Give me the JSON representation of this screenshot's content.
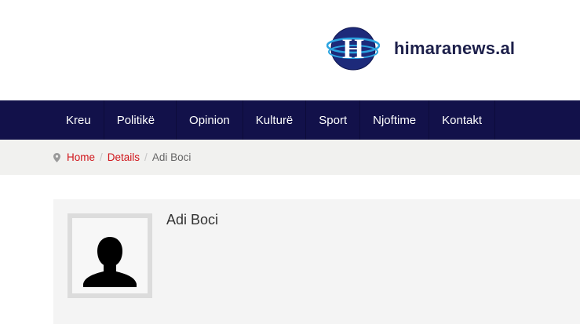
{
  "header": {
    "logo_text": "himaranews.al",
    "logo_mark_letter": "H"
  },
  "nav": {
    "items": [
      {
        "label": "Kreu"
      },
      {
        "label": "Politikë"
      },
      {
        "label": "Opinion"
      },
      {
        "label": "Kulturë"
      },
      {
        "label": "Sport"
      },
      {
        "label": "Njoftime"
      },
      {
        "label": "Kontakt"
      }
    ]
  },
  "breadcrumb": {
    "icon": "map-pin-icon",
    "items": [
      "Home",
      "Details"
    ],
    "separator": "/",
    "current": "Adi Boci"
  },
  "profile": {
    "name": "Adi Boci",
    "avatar_icon": "person-silhouette-icon"
  },
  "colors": {
    "navbar": "#12114a",
    "link": "#d0161b",
    "logo_text": "#1c1f4a",
    "logo_ring": "#2aa3e0"
  }
}
